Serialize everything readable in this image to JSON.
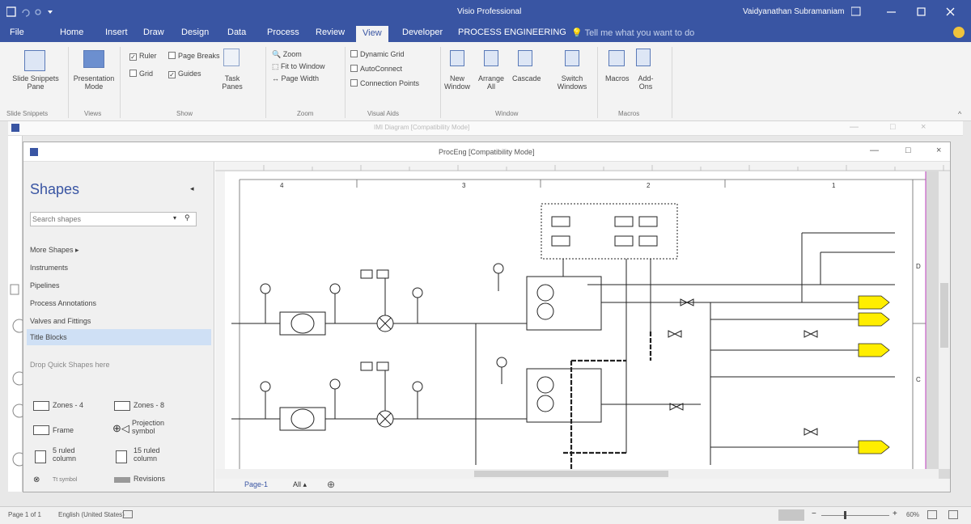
{
  "titlebar": {
    "app_title": "Visio Professional",
    "user": "Vaidyanathan Subramaniam"
  },
  "tabs": [
    "File",
    "Home",
    "Insert",
    "Draw",
    "Design",
    "Data",
    "Process",
    "Review",
    "View",
    "Developer",
    "PROCESS ENGINEERING"
  ],
  "active_tab": "View",
  "tell_me": "Tell me what you want to do",
  "ribbon": {
    "slide_snippets": {
      "button": "Slide Snippets Pane",
      "group": "Slide Snippets"
    },
    "views": {
      "button": "Presentation Mode",
      "group": "Views"
    },
    "show": {
      "ruler": "Ruler",
      "page_breaks": "Page Breaks",
      "grid": "Grid",
      "guides": "Guides",
      "task_panes": "Task Panes",
      "group": "Show"
    },
    "zoom": {
      "zoom": "Zoom",
      "fit": "Fit to Window",
      "width": "Page Width",
      "group": "Zoom"
    },
    "visual_aids": {
      "dynamic_grid": "Dynamic Grid",
      "autoconnect": "AutoConnect",
      "connection_points": "Connection Points",
      "group": "Visual Aids"
    },
    "window": {
      "new": "New Window",
      "arrange": "Arrange All",
      "cascade": "Cascade",
      "switch": "Switch Windows",
      "group": "Window"
    },
    "macros": {
      "macros": "Macros",
      "addons": "Add-Ons",
      "group": "Macros"
    }
  },
  "outer_window_title": "IMI Diagram [Compatibility Mode]",
  "inner_window_title": "ProcEng [Compatibility Mode]",
  "shapes_pane": {
    "title": "Shapes",
    "search_placeholder": "Search shapes",
    "more_shapes": "More Shapes",
    "items": [
      "Instruments",
      "Pipelines",
      "Process Annotations",
      "Valves and Fittings",
      "Title Blocks"
    ],
    "selected_item": "Title Blocks",
    "drop_hint": "Drop Quick Shapes here",
    "stencils": [
      "Zones - 4",
      "Zones - 8",
      "Frame",
      "Projection symbol",
      "5 ruled column",
      "15 ruled column",
      "Tt symbol",
      "Revisions"
    ]
  },
  "page_tabs": {
    "page": "Page-1",
    "all": "All"
  },
  "rulers": {
    "top": [
      "4",
      "3",
      "2",
      "1"
    ],
    "right": [
      "D",
      "C"
    ]
  },
  "statusbar": {
    "page": "Page 1 of 1",
    "language": "English (United States)",
    "zoom": "60%"
  },
  "colors": {
    "accent": "#3955a3",
    "yellow": "#ffee00",
    "pipe": "#222222",
    "selection": "#cfe0f5"
  }
}
